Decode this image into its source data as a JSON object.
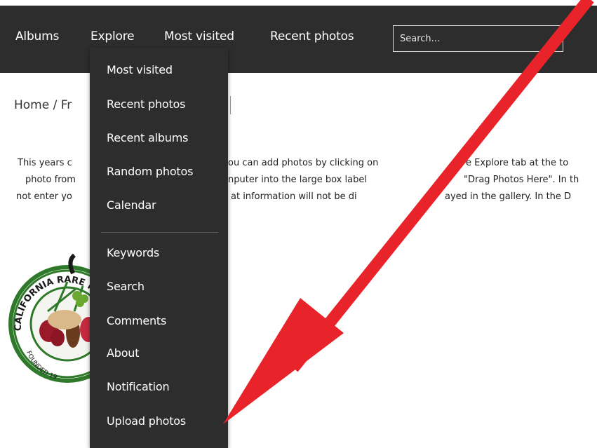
{
  "nav": {
    "albums": "Albums",
    "explore": "Explore",
    "most_visited": "Most visited",
    "recent_photos": "Recent photos",
    "search_placeholder": "Search..."
  },
  "breadcrumb": "Home / Fr",
  "intro": {
    "line1_left": "This years c",
    "line1_mid": "ou can add photos by clicking on",
    "line1_right": "e Explore tab at the to",
    "line2_left": "photo from",
    "line2_mid": "nputer into the large box label",
    "line2_right": "\"Drag Photos Here\". In th",
    "line3_left": "not enter yo",
    "line3_mid": "at information will not be di",
    "line3_right": "ayed in the gallery. In the D"
  },
  "logo": {
    "ring_text": "CALIFORNIA RARE FRU",
    "founded_text": "FOUNDED 19"
  },
  "dropdown": {
    "items": [
      "Most visited",
      "Recent photos",
      "Recent albums",
      "Random photos",
      "Calendar",
      "Keywords",
      "Search",
      "Comments",
      "About",
      "Notification",
      "Upload photos"
    ]
  },
  "colors": {
    "topbar": "#2d2d2d",
    "menu": "#2d2d2d",
    "arrow": "#e8232a"
  }
}
